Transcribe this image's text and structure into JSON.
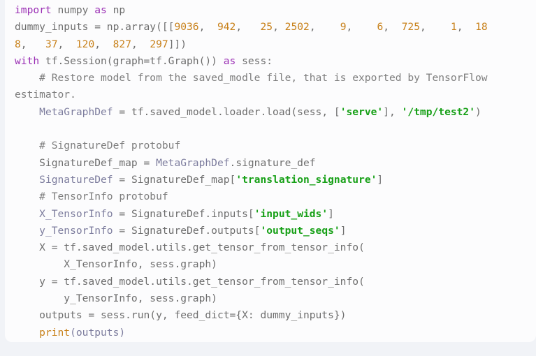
{
  "code_block": {
    "language": "python",
    "background_color": "#fcfcfd",
    "page_background_color": "#f1f3f7",
    "colors": {
      "keyword": "#9b30b5",
      "number": "#c8811a",
      "string": "#17a017",
      "comment": "#7e7e7e",
      "variable": "#7d7d9e",
      "builtin_function": "#c8811a",
      "plain": "#6e6e6e"
    },
    "lines": [
      {
        "index": 1,
        "text": "import numpy as np",
        "tokens": [
          {
            "t": "import",
            "c": "kw"
          },
          {
            "t": " numpy ",
            "c": "pln"
          },
          {
            "t": "as",
            "c": "kw"
          },
          {
            "t": " np",
            "c": "pln"
          }
        ]
      },
      {
        "index": 2,
        "text": "dummy_inputs = np.array([[9036,  942,   25, 2502,    9,    6,  725,    1, 18",
        "tokens": [
          {
            "t": "dummy_inputs = np.array([[",
            "c": "pln"
          },
          {
            "t": "9036",
            "c": "num"
          },
          {
            "t": ", ",
            "c": "pln"
          },
          {
            "t": " 942",
            "c": "num"
          },
          {
            "t": ", ",
            "c": "pln"
          },
          {
            "t": "  25",
            "c": "num"
          },
          {
            "t": ", ",
            "c": "pln"
          },
          {
            "t": "2502",
            "c": "num"
          },
          {
            "t": ", ",
            "c": "pln"
          },
          {
            "t": "   9",
            "c": "num"
          },
          {
            "t": ", ",
            "c": "pln"
          },
          {
            "t": "   6",
            "c": "num"
          },
          {
            "t": ", ",
            "c": "pln"
          },
          {
            "t": " 725",
            "c": "num"
          },
          {
            "t": ", ",
            "c": "pln"
          },
          {
            "t": "   1",
            "c": "num"
          },
          {
            "t": ", ",
            "c": "pln"
          },
          {
            "t": " 18",
            "c": "num"
          }
        ]
      },
      {
        "index": 3,
        "text": "8,   37,  120,  827,  297]])",
        "wrapped_continuation": true,
        "tokens": [
          {
            "t": "8",
            "c": "num"
          },
          {
            "t": ", ",
            "c": "pln"
          },
          {
            "t": "  37",
            "c": "num"
          },
          {
            "t": ", ",
            "c": "pln"
          },
          {
            "t": " 120",
            "c": "num"
          },
          {
            "t": ", ",
            "c": "pln"
          },
          {
            "t": " 827",
            "c": "num"
          },
          {
            "t": ", ",
            "c": "pln"
          },
          {
            "t": " 297",
            "c": "num"
          },
          {
            "t": "]])",
            "c": "pln"
          }
        ]
      },
      {
        "index": 4,
        "text": "with tf.Session(graph=tf.Graph()) as sess:",
        "tokens": [
          {
            "t": "with",
            "c": "kw"
          },
          {
            "t": " tf.Session(graph=tf.Graph()) ",
            "c": "pln"
          },
          {
            "t": "as",
            "c": "kw"
          },
          {
            "t": " sess:",
            "c": "pln"
          }
        ]
      },
      {
        "index": 5,
        "text": "    # Restore model from the saved_modle file, that is exported by TensorFlow",
        "tokens": [
          {
            "t": "    # Restore model from the saved_modle file, that is exported by TensorFlow",
            "c": "cmt"
          }
        ]
      },
      {
        "index": 6,
        "text": "estimator.",
        "wrapped_continuation": true,
        "tokens": [
          {
            "t": "estimator.",
            "c": "cmt"
          }
        ]
      },
      {
        "index": 7,
        "text": "    MetaGraphDef = tf.saved_model.loader.load(sess, ['serve'], '/tmp/test2')",
        "tokens": [
          {
            "t": "    ",
            "c": "pln"
          },
          {
            "t": "MetaGraphDef",
            "c": "var"
          },
          {
            "t": " = tf.saved_model.loader.load(sess, [",
            "c": "pln"
          },
          {
            "t": "'serve'",
            "c": "str"
          },
          {
            "t": "], ",
            "c": "pln"
          },
          {
            "t": "'/tmp/test2'",
            "c": "str"
          },
          {
            "t": ")",
            "c": "pln"
          }
        ]
      },
      {
        "index": 8,
        "text": "",
        "tokens": []
      },
      {
        "index": 9,
        "text": "    # SignatureDef protobuf",
        "tokens": [
          {
            "t": "    # SignatureDef protobuf",
            "c": "cmt"
          }
        ]
      },
      {
        "index": 10,
        "text": "    SignatureDef_map = MetaGraphDef.signature_def",
        "tokens": [
          {
            "t": "    SignatureDef_map = ",
            "c": "pln"
          },
          {
            "t": "MetaGraphDef",
            "c": "var"
          },
          {
            "t": ".signature_def",
            "c": "pln"
          }
        ]
      },
      {
        "index": 11,
        "text": "    SignatureDef = SignatureDef_map['translation_signature']",
        "tokens": [
          {
            "t": "    ",
            "c": "pln"
          },
          {
            "t": "SignatureDef",
            "c": "var"
          },
          {
            "t": " = SignatureDef_map[",
            "c": "pln"
          },
          {
            "t": "'translation_signature'",
            "c": "str"
          },
          {
            "t": "]",
            "c": "pln"
          }
        ]
      },
      {
        "index": 12,
        "text": "    # TensorInfo protobuf",
        "tokens": [
          {
            "t": "    # TensorInfo protobuf",
            "c": "cmt"
          }
        ]
      },
      {
        "index": 13,
        "text": "    X_TensorInfo = SignatureDef.inputs['input_wids']",
        "tokens": [
          {
            "t": "    ",
            "c": "pln"
          },
          {
            "t": "X_TensorInfo",
            "c": "var"
          },
          {
            "t": " = SignatureDef.inputs[",
            "c": "pln"
          },
          {
            "t": "'input_wids'",
            "c": "str"
          },
          {
            "t": "]",
            "c": "pln"
          }
        ]
      },
      {
        "index": 14,
        "text": "    y_TensorInfo = SignatureDef.outputs['output_seqs']",
        "tokens": [
          {
            "t": "    ",
            "c": "pln"
          },
          {
            "t": "y_TensorInfo",
            "c": "var"
          },
          {
            "t": " = SignatureDef.outputs[",
            "c": "pln"
          },
          {
            "t": "'output_seqs'",
            "c": "str"
          },
          {
            "t": "]",
            "c": "pln"
          }
        ]
      },
      {
        "index": 15,
        "text": "    X = tf.saved_model.utils.get_tensor_from_tensor_info(",
        "tokens": [
          {
            "t": "    X = tf.saved_model.utils.get_tensor_from_tensor_info(",
            "c": "pln"
          }
        ]
      },
      {
        "index": 16,
        "text": "        X_TensorInfo, sess.graph)",
        "tokens": [
          {
            "t": "        X_TensorInfo, sess.graph)",
            "c": "pln"
          }
        ]
      },
      {
        "index": 17,
        "text": "    y = tf.saved_model.utils.get_tensor_from_tensor_info(",
        "tokens": [
          {
            "t": "    y = tf.saved_model.utils.get_tensor_from_tensor_info(",
            "c": "pln"
          }
        ]
      },
      {
        "index": 18,
        "text": "        y_TensorInfo, sess.graph)",
        "tokens": [
          {
            "t": "        y_TensorInfo, sess.graph)",
            "c": "pln"
          }
        ]
      },
      {
        "index": 19,
        "text": "    outputs = sess.run(y, feed_dict={X: dummy_inputs})",
        "tokens": [
          {
            "t": "    outputs = sess.run(y, feed_dict={X: dummy_inputs})",
            "c": "pln"
          }
        ]
      },
      {
        "index": 20,
        "text": "    print(outputs)",
        "tokens": [
          {
            "t": "    ",
            "c": "pln"
          },
          {
            "t": "print",
            "c": "fn"
          },
          {
            "t": "(outputs)",
            "c": "var"
          }
        ]
      }
    ]
  }
}
